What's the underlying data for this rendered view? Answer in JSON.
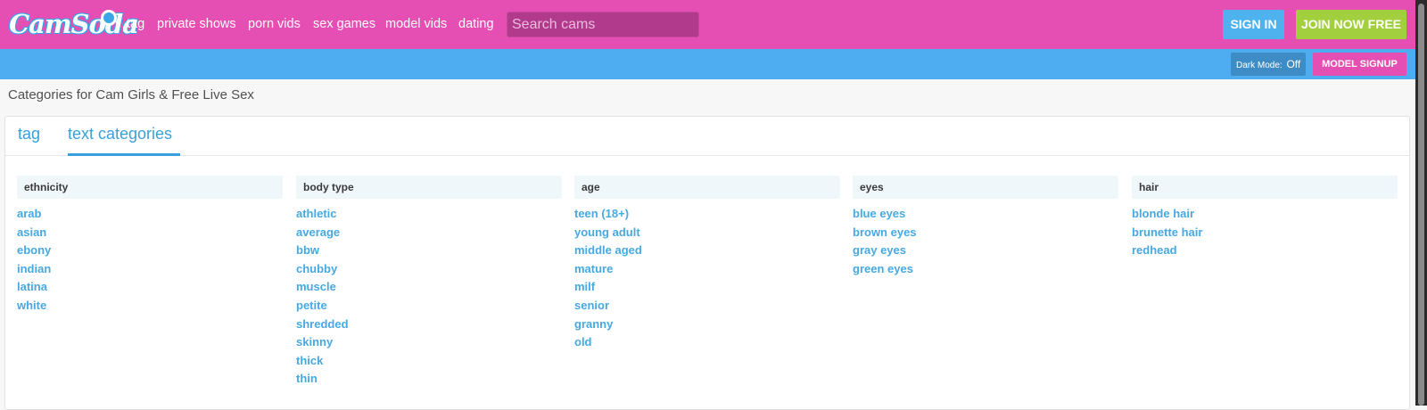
{
  "header": {
    "logo_text": "CamSoda",
    "nav": [
      "tag",
      "private shows",
      "porn vids",
      "sex games",
      "model vids",
      "dating"
    ],
    "search_placeholder": "Search cams",
    "sign_in": "SIGN IN",
    "join": "JOIN NOW FREE"
  },
  "subbar": {
    "dark_mode_label": "Dark Mode:",
    "dark_mode_value": "Off",
    "model_signup": "MODEL SIGNUP"
  },
  "page_title": "Categories for Cam Girls & Free Live Sex",
  "tabs": [
    {
      "label": "tag",
      "active": false
    },
    {
      "label": "text categories",
      "active": true
    }
  ],
  "categories": [
    {
      "heading": "ethnicity",
      "items": [
        "arab",
        "asian",
        "ebony",
        "indian",
        "latina",
        "white"
      ]
    },
    {
      "heading": "body type",
      "items": [
        "athletic",
        "average",
        "bbw",
        "chubby",
        "muscle",
        "petite",
        "shredded",
        "skinny",
        "thick",
        "thin"
      ]
    },
    {
      "heading": "age",
      "items": [
        "teen (18+)",
        "young adult",
        "middle aged",
        "mature",
        "milf",
        "senior",
        "granny",
        "old"
      ]
    },
    {
      "heading": "eyes",
      "items": [
        "blue eyes",
        "brown eyes",
        "gray eyes",
        "green eyes"
      ]
    },
    {
      "heading": "hair",
      "items": [
        "blonde hair",
        "brunette hair",
        "redhead"
      ]
    }
  ],
  "colors": {
    "header_pink": "#e54fb3",
    "subbar_blue": "#4eadf0",
    "link_blue": "#46a9e2",
    "join_green": "#a2cf3d"
  }
}
